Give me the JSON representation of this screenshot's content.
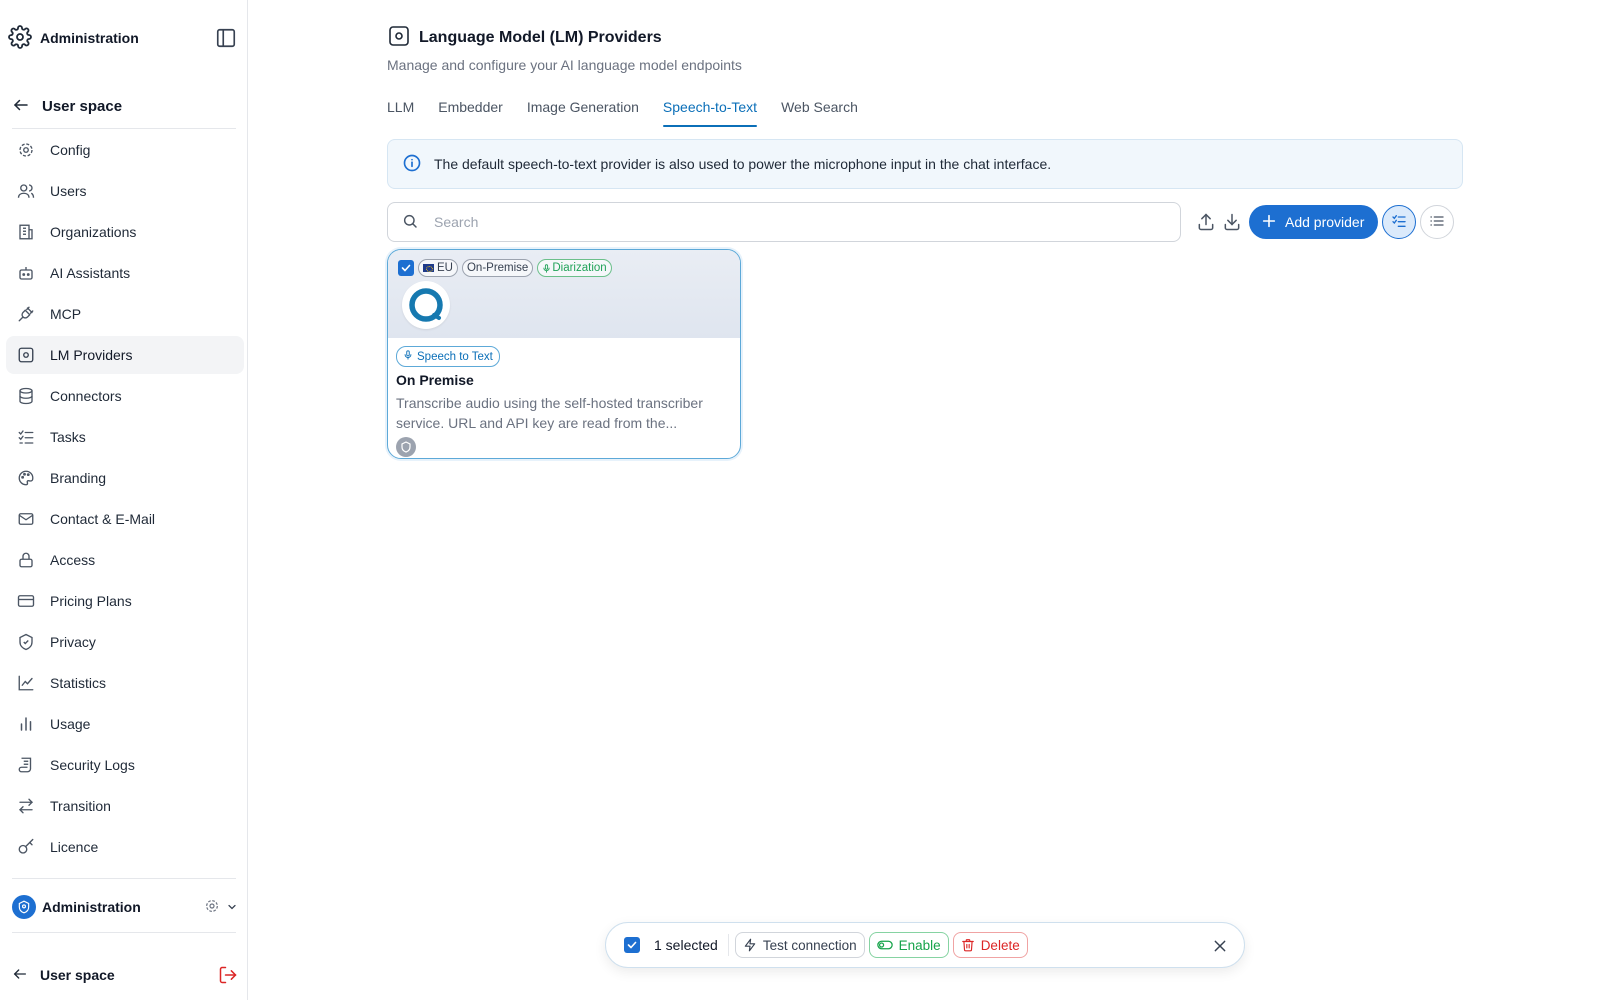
{
  "sidebar": {
    "header_title": "Administration",
    "back_label": "User space",
    "items": [
      {
        "label": "Config",
        "icon": "gear-icon"
      },
      {
        "label": "Users",
        "icon": "users-icon"
      },
      {
        "label": "Organizations",
        "icon": "building-icon"
      },
      {
        "label": "AI Assistants",
        "icon": "bot-icon"
      },
      {
        "label": "MCP",
        "icon": "plug-icon"
      },
      {
        "label": "LM Providers",
        "icon": "cpu-icon",
        "active": true
      },
      {
        "label": "Connectors",
        "icon": "database-icon"
      },
      {
        "label": "Tasks",
        "icon": "list-check-icon"
      },
      {
        "label": "Branding",
        "icon": "palette-icon"
      },
      {
        "label": "Contact & E-Mail",
        "icon": "mail-icon"
      },
      {
        "label": "Access",
        "icon": "lock-icon"
      },
      {
        "label": "Pricing Plans",
        "icon": "credit-card-icon"
      },
      {
        "label": "Privacy",
        "icon": "shield-icon"
      },
      {
        "label": "Statistics",
        "icon": "chart-line-icon"
      },
      {
        "label": "Usage",
        "icon": "bar-chart-icon"
      },
      {
        "label": "Security Logs",
        "icon": "scroll-icon"
      },
      {
        "label": "Transition",
        "icon": "arrows-swap-icon"
      },
      {
        "label": "Licence",
        "icon": "key-icon"
      }
    ],
    "org_label": "Administration",
    "footer_user_label": "User space"
  },
  "page": {
    "title": "Language Model (LM) Providers",
    "subtitle": "Manage and configure your AI language model endpoints"
  },
  "tabs": [
    {
      "label": "LLM"
    },
    {
      "label": "Embedder"
    },
    {
      "label": "Image Generation"
    },
    {
      "label": "Speech-to-Text",
      "active": true
    },
    {
      "label": "Web Search"
    }
  ],
  "info_banner": "The default speech-to-text provider is also used to power the microphone input in the chat interface.",
  "search": {
    "placeholder": "Search",
    "value": ""
  },
  "toolbar": {
    "add_label": "Add provider"
  },
  "card": {
    "tags": [
      "EU",
      "On-Premise",
      "Diarization"
    ],
    "type_label": "Speech to Text",
    "title": "On Premise",
    "description": "Transcribe audio using the self-hosted transcriber service. URL and API key are read from the...",
    "selected": true
  },
  "selection_bar": {
    "count_label": "1 selected",
    "test_label": "Test connection",
    "enable_label": "Enable",
    "delete_label": "Delete"
  },
  "colors": {
    "accent": "#1d6fd1",
    "tab_active": "#0b6fb8",
    "enable": "#16a34a",
    "delete": "#dc2626",
    "diarization": "#22a35a"
  }
}
